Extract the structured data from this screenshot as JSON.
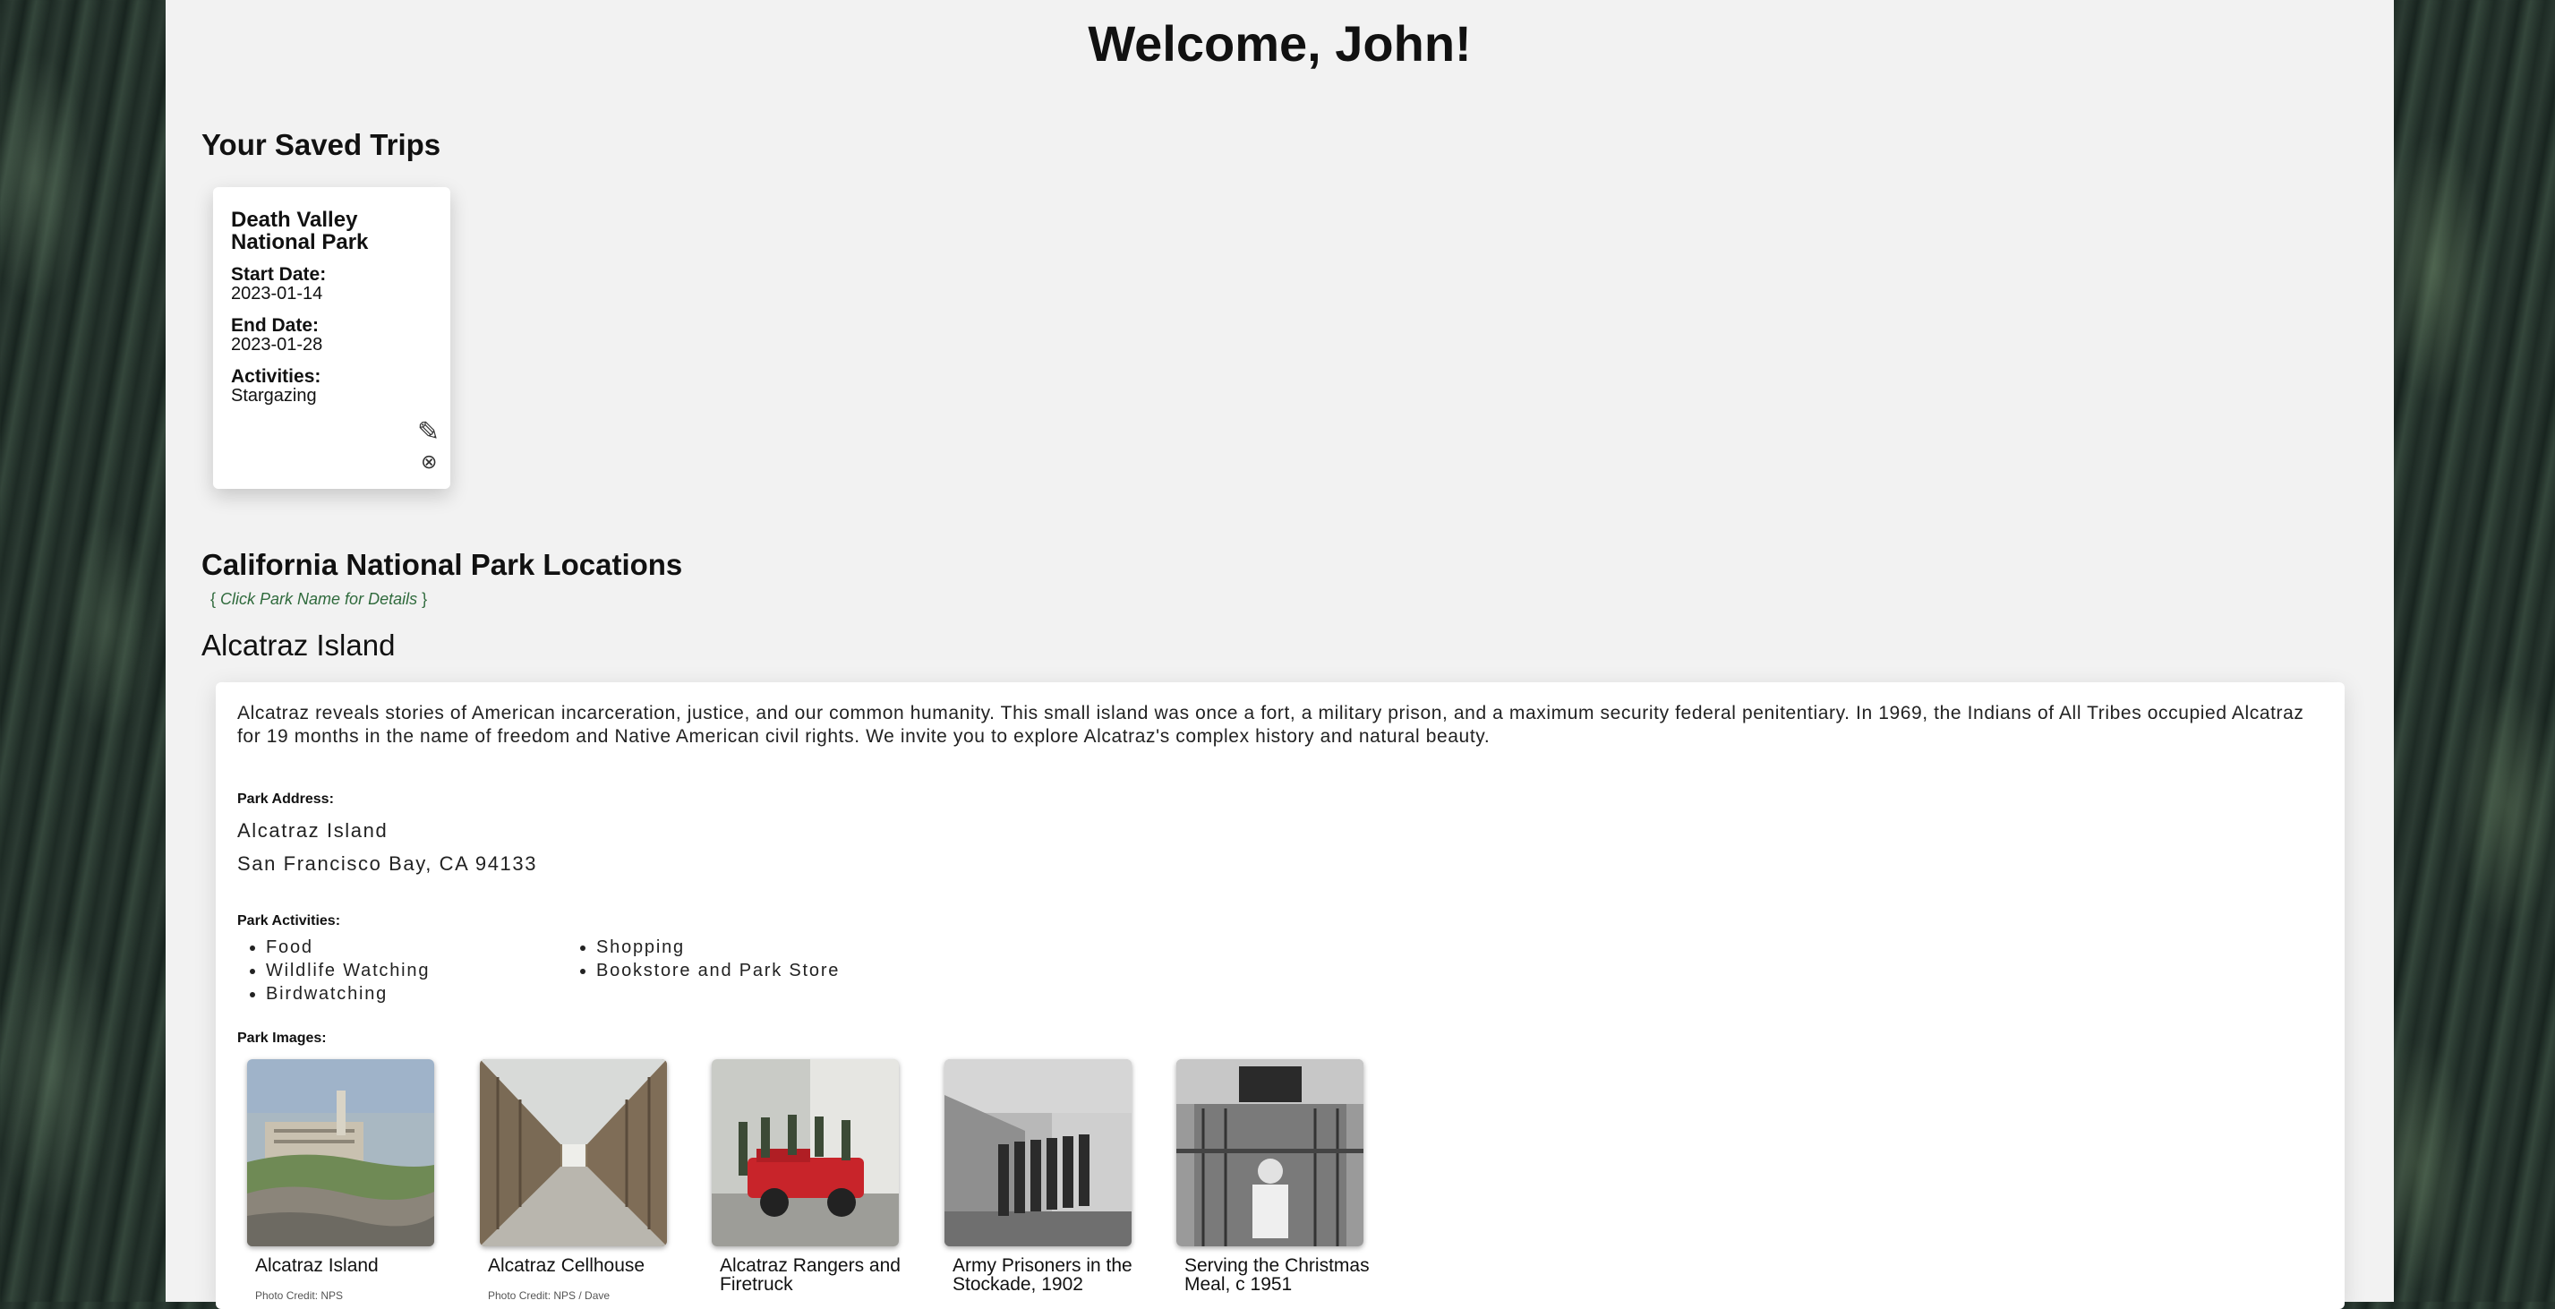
{
  "welcome": "Welcome, John!",
  "saved_trips": {
    "heading": "Your Saved Trips",
    "trips": [
      {
        "park": "Death Valley National Park",
        "start_label": "Start Date:",
        "start": "2023-01-14",
        "end_label": "End Date:",
        "end": "2023-01-28",
        "activities_label": "Activities:",
        "activities": "Stargazing",
        "edit_icon": "✎",
        "delete_icon": "⊗"
      }
    ]
  },
  "locations": {
    "heading": "California National Park Locations",
    "hint_open": "{",
    "hint": "Click Park Name for Details",
    "hint_close": "}"
  },
  "park": {
    "name": "Alcatraz Island",
    "description": "Alcatraz reveals stories of American incarceration, justice, and our common humanity. This small island was once a fort, a military prison, and a maximum security federal penitentiary. In 1969, the Indians of All Tribes occupied Alcatraz for 19 months in the name of freedom and Native American civil rights. We invite you to explore Alcatraz's complex history and natural beauty.",
    "address_label": "Park Address:",
    "address_line1": "Alcatraz Island",
    "address_line2": "San Francisco Bay, CA 94133",
    "activities_label": "Park Activities:",
    "activities_col1": [
      "Food",
      "Wildlife Watching",
      "Birdwatching"
    ],
    "activities_col2": [
      "Shopping",
      "Bookstore and Park Store"
    ],
    "images_label": "Park Images:",
    "images": [
      {
        "caption": "Alcatraz Island",
        "credit": "Photo Credit: NPS"
      },
      {
        "caption": "Alcatraz Cellhouse",
        "credit": "Photo Credit: NPS / Dave"
      },
      {
        "caption": "Alcatraz Rangers and Firetruck",
        "credit": ""
      },
      {
        "caption": "Army Prisoners in the Stockade, 1902",
        "credit": ""
      },
      {
        "caption": "Serving the Christmas Meal, c 1951",
        "credit": ""
      }
    ]
  }
}
